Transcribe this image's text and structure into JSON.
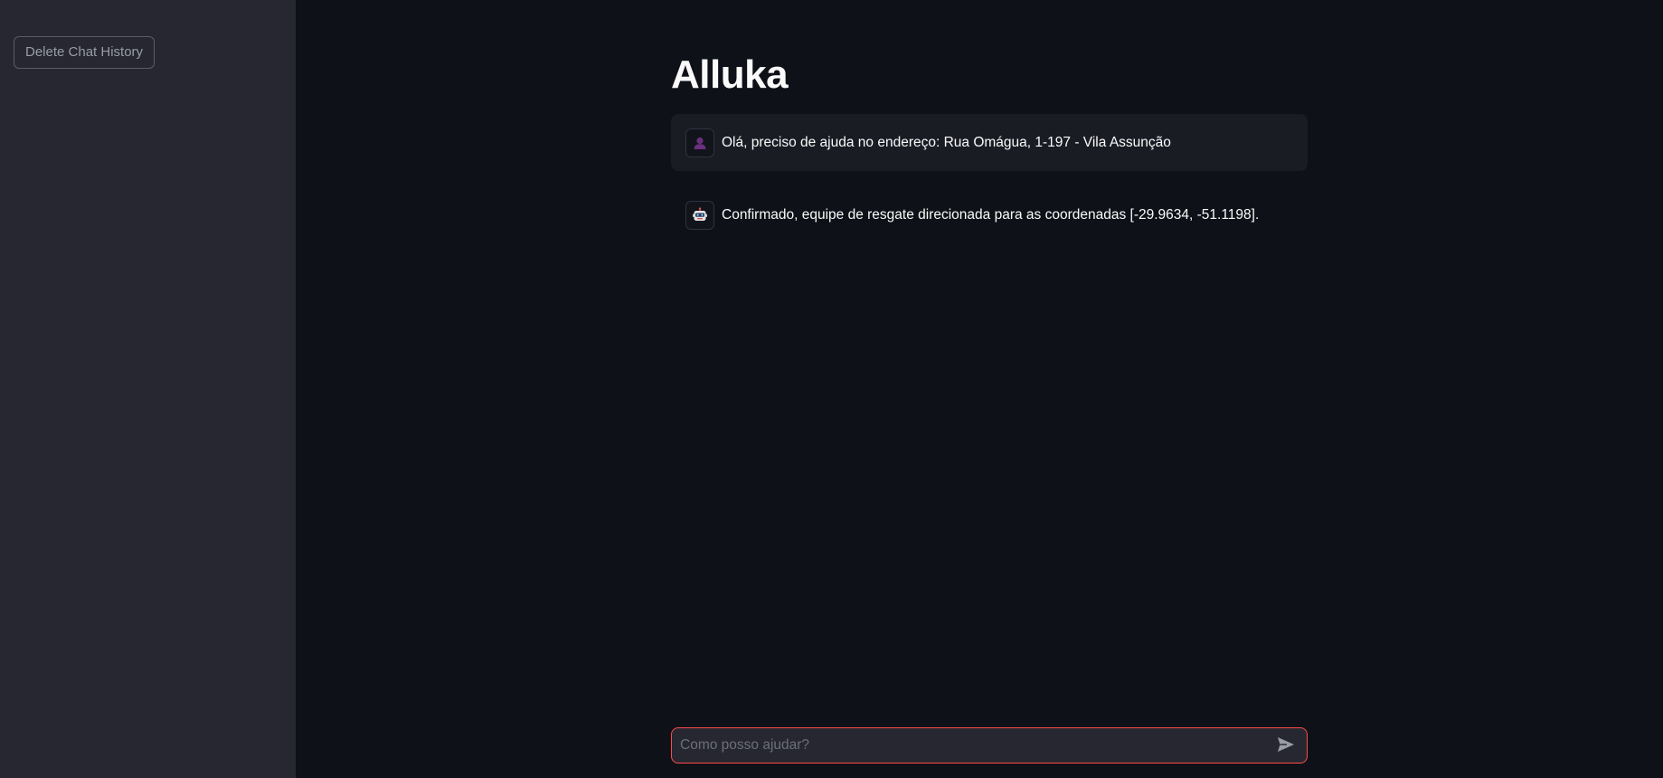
{
  "sidebar": {
    "delete_button_label": "Delete Chat History"
  },
  "main": {
    "title": "Alluka",
    "messages": [
      {
        "role": "user",
        "avatar_icon": "user-icon",
        "text": "Olá, preciso de ajuda no endereço: Rua Omágua, 1-197 - Vila Assunção"
      },
      {
        "role": "assistant",
        "avatar_icon": "robot-icon",
        "text": "Confirmado, equipe de resgate direcionada para as coordenadas [-29.9634, -51.1198]."
      }
    ]
  },
  "chat_input": {
    "value": "",
    "placeholder": "Como posso ajudar?",
    "send_icon": "send-icon"
  },
  "colors": {
    "background": "#0e1117",
    "sidebar": "#262730",
    "user_message_bg": "#1a1c24",
    "accent": "#ff4b4b",
    "text": "#fafafa",
    "user_avatar": "#7d3c98"
  }
}
